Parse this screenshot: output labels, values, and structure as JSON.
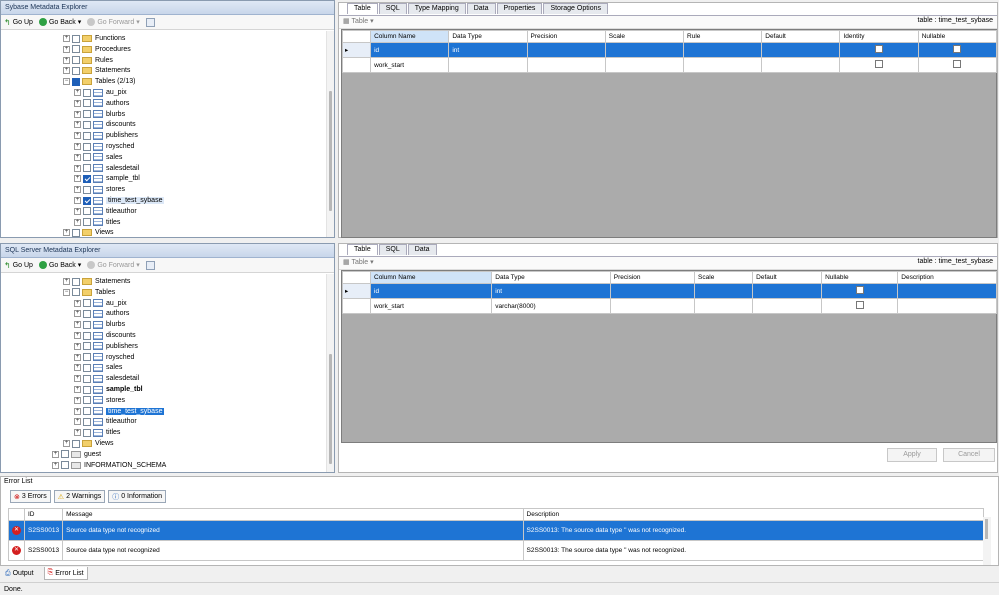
{
  "sybase_explorer": {
    "title": "Sybase Metadata Explorer",
    "toolbar": {
      "go_up": "Go Up",
      "go_back": "Go Back",
      "go_forward": "Go Forward"
    },
    "tree": [
      {
        "label": "Functions",
        "kind": "folder",
        "indent": 0
      },
      {
        "label": "Procedures",
        "kind": "folder",
        "indent": 0
      },
      {
        "label": "Rules",
        "kind": "folder",
        "indent": 0
      },
      {
        "label": "Statements",
        "kind": "folder",
        "indent": 0
      },
      {
        "label": "Tables (2/13)",
        "kind": "folder-open",
        "indent": 0
      },
      {
        "label": "au_pix",
        "kind": "table",
        "indent": 1
      },
      {
        "label": "authors",
        "kind": "table",
        "indent": 1
      },
      {
        "label": "blurbs",
        "kind": "table",
        "indent": 1
      },
      {
        "label": "discounts",
        "kind": "table",
        "indent": 1
      },
      {
        "label": "publishers",
        "kind": "table",
        "indent": 1
      },
      {
        "label": "roysched",
        "kind": "table",
        "indent": 1
      },
      {
        "label": "sales",
        "kind": "table",
        "indent": 1
      },
      {
        "label": "salesdetail",
        "kind": "table",
        "indent": 1
      },
      {
        "label": "sample_tbl",
        "kind": "table",
        "indent": 1,
        "checked": true
      },
      {
        "label": "stores",
        "kind": "table",
        "indent": 1
      },
      {
        "label": "time_test_sybase",
        "kind": "table",
        "indent": 1,
        "checked": true,
        "highlight": true
      },
      {
        "label": "titleauthor",
        "kind": "table",
        "indent": 1
      },
      {
        "label": "titles",
        "kind": "table",
        "indent": 1
      },
      {
        "label": "Views",
        "kind": "folder",
        "indent": 0
      }
    ]
  },
  "sqlserver_explorer": {
    "title": "SQL Server Metadata Explorer",
    "toolbar": {
      "go_up": "Go Up",
      "go_back": "Go Back",
      "go_forward": "Go Forward"
    },
    "tree": [
      {
        "label": "Statements",
        "kind": "folder",
        "indent": 0
      },
      {
        "label": "Tables",
        "kind": "folder-open",
        "indent": 0
      },
      {
        "label": "au_pix",
        "kind": "table",
        "indent": 1
      },
      {
        "label": "authors",
        "kind": "table",
        "indent": 1
      },
      {
        "label": "blurbs",
        "kind": "table",
        "indent": 1
      },
      {
        "label": "discounts",
        "kind": "table",
        "indent": 1
      },
      {
        "label": "publishers",
        "kind": "table",
        "indent": 1
      },
      {
        "label": "roysched",
        "kind": "table",
        "indent": 1
      },
      {
        "label": "sales",
        "kind": "table",
        "indent": 1
      },
      {
        "label": "salesdetail",
        "kind": "table",
        "indent": 1
      },
      {
        "label": "sample_tbl",
        "kind": "table",
        "indent": 1,
        "bold": true
      },
      {
        "label": "stores",
        "kind": "table",
        "indent": 1
      },
      {
        "label": "time_test_sybase",
        "kind": "table",
        "indent": 1,
        "selected": true
      },
      {
        "label": "titleauthor",
        "kind": "table",
        "indent": 1
      },
      {
        "label": "titles",
        "kind": "table",
        "indent": 1
      },
      {
        "label": "Views",
        "kind": "folder",
        "indent": 0
      },
      {
        "label": "guest",
        "kind": "schema",
        "indent": -1
      },
      {
        "label": "INFORMATION_SCHEMA",
        "kind": "schema",
        "indent": -1
      }
    ]
  },
  "sybase_table": {
    "tabs": [
      "Table",
      "SQL",
      "Type Mapping",
      "Data",
      "Properties",
      "Storage Options"
    ],
    "dropdown": "Table",
    "table_label": "table : time_test_sybase",
    "columns": [
      "Column Name",
      "Data Type",
      "Precision",
      "Scale",
      "Rule",
      "Default",
      "Identity",
      "Nullable"
    ],
    "rows": [
      {
        "name": "id",
        "type": "int",
        "identity": false,
        "nullable": false
      },
      {
        "name": "work_start",
        "type": "",
        "identity": false,
        "nullable": false
      }
    ]
  },
  "sqlserver_table": {
    "tabs": [
      "Table",
      "SQL",
      "Data"
    ],
    "dropdown": "Table",
    "table_label": "table : time_test_sybase",
    "columns": [
      "Column Name",
      "Data Type",
      "Precision",
      "Scale",
      "Default",
      "Nullable",
      "Description"
    ],
    "rows": [
      {
        "name": "id",
        "type": "int",
        "nullable": false
      },
      {
        "name": "work_start",
        "type": "varchar(8000)",
        "nullable": false
      }
    ],
    "apply": "Apply",
    "cancel": "Cancel"
  },
  "error_list": {
    "title": "Error List",
    "filters": {
      "errors": "3 Errors",
      "warnings": "2 Warnings",
      "info": "0 Information"
    },
    "columns": [
      "ID",
      "Message",
      "Description"
    ],
    "rows": [
      {
        "id": "S2SS0013",
        "message": "Source data type not recognized",
        "description": "S2SS0013: The source data type '' was not recognized."
      },
      {
        "id": "S2SS0013",
        "message": "Source data type not recognized",
        "description": "S2SS0013: The source data type '' was not recognized."
      }
    ]
  },
  "bottom_tabs": [
    "Output",
    "Error List"
  ],
  "status": "Done.",
  "colors": {
    "selection": "#1e74d4",
    "panel_border": "#8a9bb0"
  }
}
